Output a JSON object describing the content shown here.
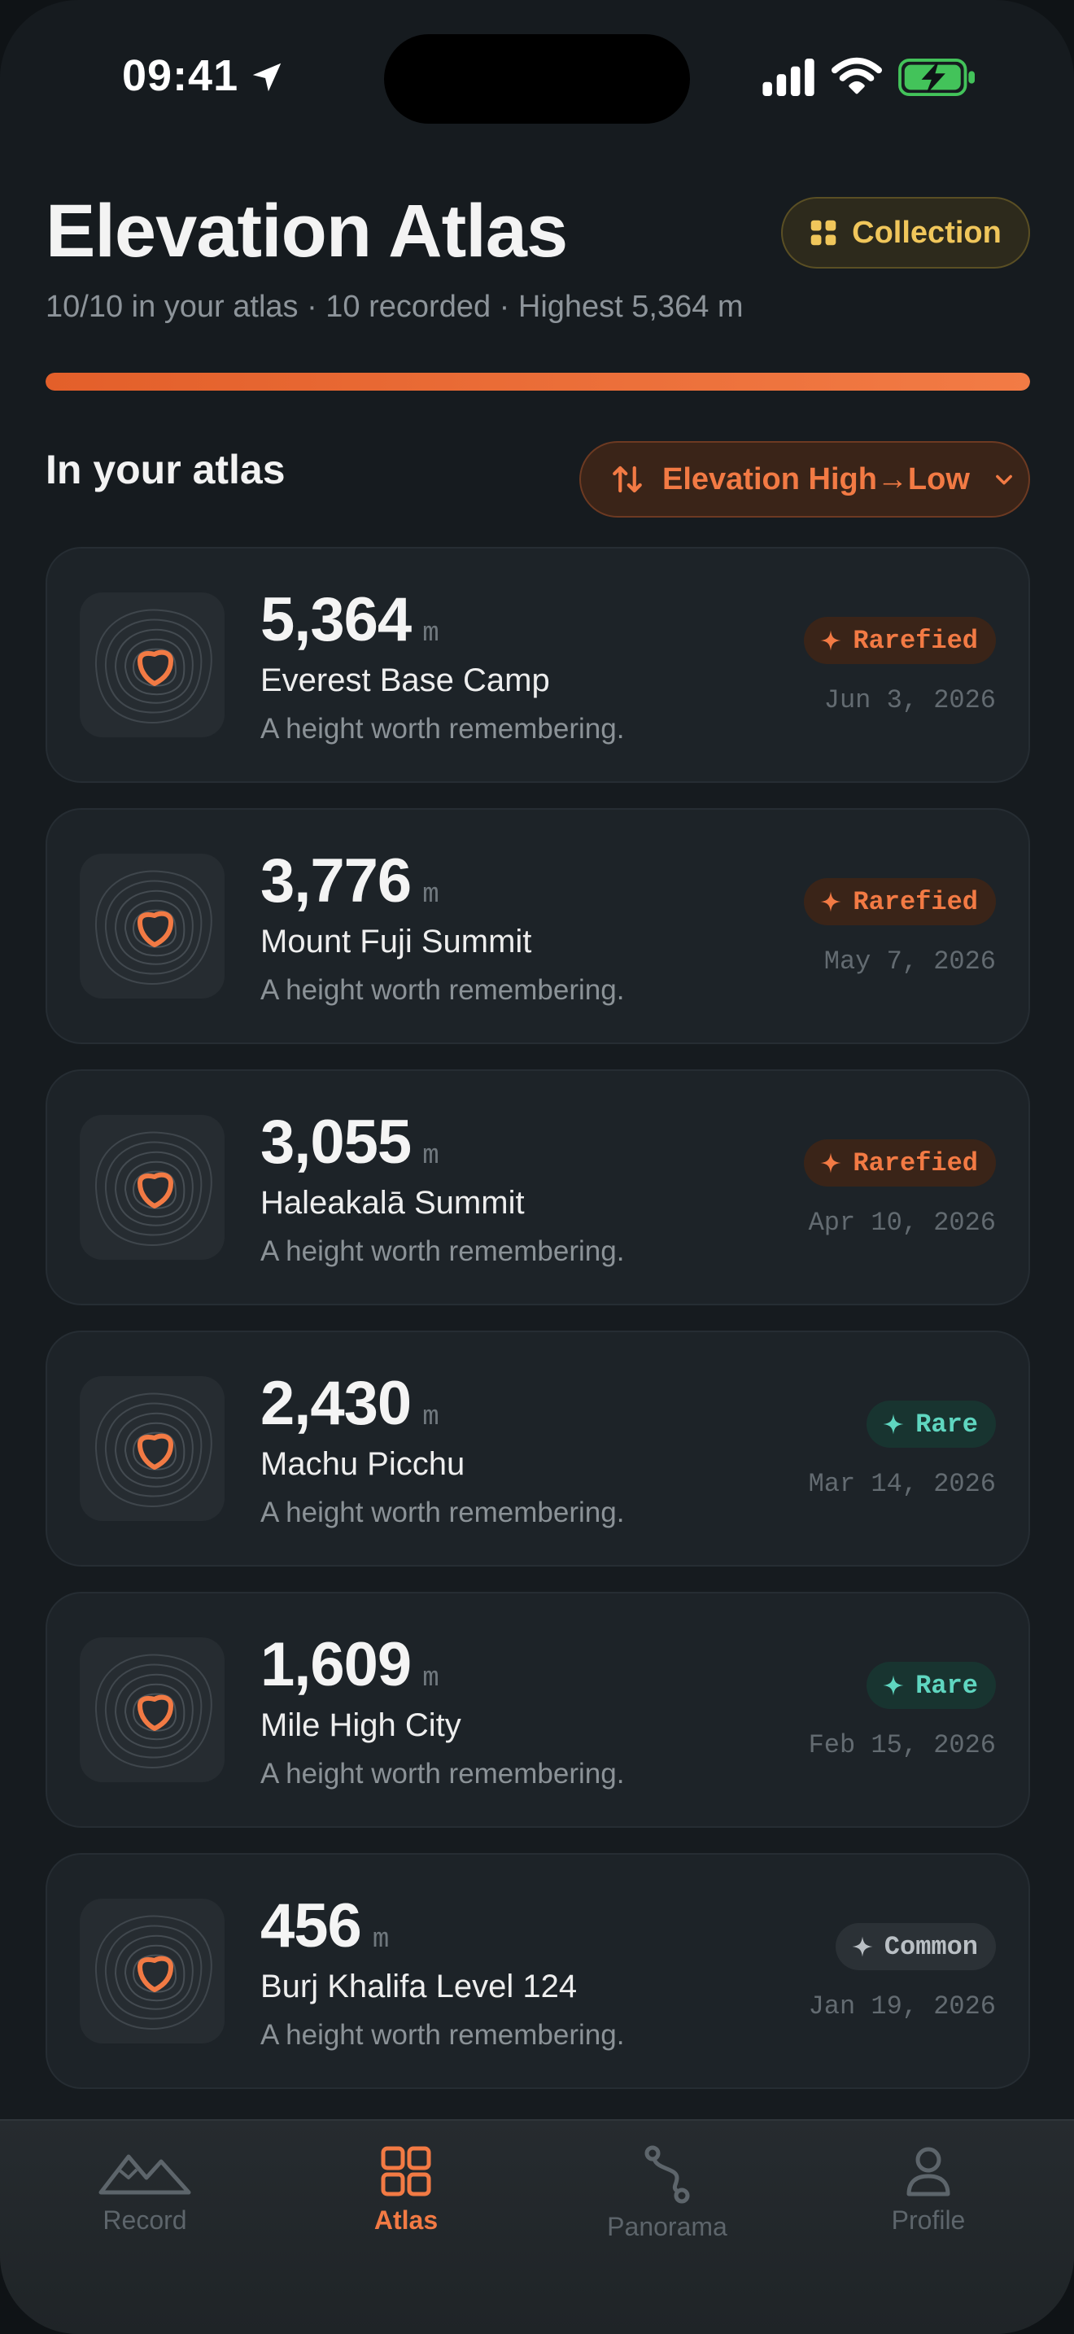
{
  "status_bar": {
    "time": "09:41"
  },
  "header": {
    "title": "Elevation Atlas",
    "collection_label": "Collection",
    "subtitle": "10/10 in your atlas · 10 recorded · Highest 5,364 m",
    "progress_fraction": 1.0
  },
  "section": {
    "title": "In your atlas",
    "sort_label": "Elevation High→Low"
  },
  "entries": [
    {
      "elevation": "5,364",
      "unit": "m",
      "name": "Everest Base Camp",
      "tagline": "A height worth remembering.",
      "tier": "Rarefied",
      "date": "Jun 3, 2026"
    },
    {
      "elevation": "3,776",
      "unit": "m",
      "name": "Mount Fuji Summit",
      "tagline": "A height worth remembering.",
      "tier": "Rarefied",
      "date": "May 7, 2026"
    },
    {
      "elevation": "3,055",
      "unit": "m",
      "name": "Haleakalā Summit",
      "tagline": "A height worth remembering.",
      "tier": "Rarefied",
      "date": "Apr 10, 2026"
    },
    {
      "elevation": "2,430",
      "unit": "m",
      "name": "Machu Picchu",
      "tagline": "A height worth remembering.",
      "tier": "Rare",
      "date": "Mar 14, 2026"
    },
    {
      "elevation": "1,609",
      "unit": "m",
      "name": "Mile High City",
      "tagline": "A height worth remembering.",
      "tier": "Rare",
      "date": "Feb 15, 2026"
    },
    {
      "elevation": "456",
      "unit": "m",
      "name": "Burj Khalifa Level 124",
      "tagline": "A height worth remembering.",
      "tier": "Common",
      "date": "Jan 19, 2026"
    }
  ],
  "tabs": [
    {
      "label": "Record",
      "icon": "mountains-icon",
      "active": false
    },
    {
      "label": "Atlas",
      "icon": "grid-icon",
      "active": true
    },
    {
      "label": "Panorama",
      "icon": "route-icon",
      "active": false
    },
    {
      "label": "Profile",
      "icon": "person-icon",
      "active": false
    }
  ],
  "colors": {
    "accent": "#f27a44",
    "gold": "#f0c65b",
    "rare": "#5fd6c0",
    "background": "#161b1f"
  }
}
